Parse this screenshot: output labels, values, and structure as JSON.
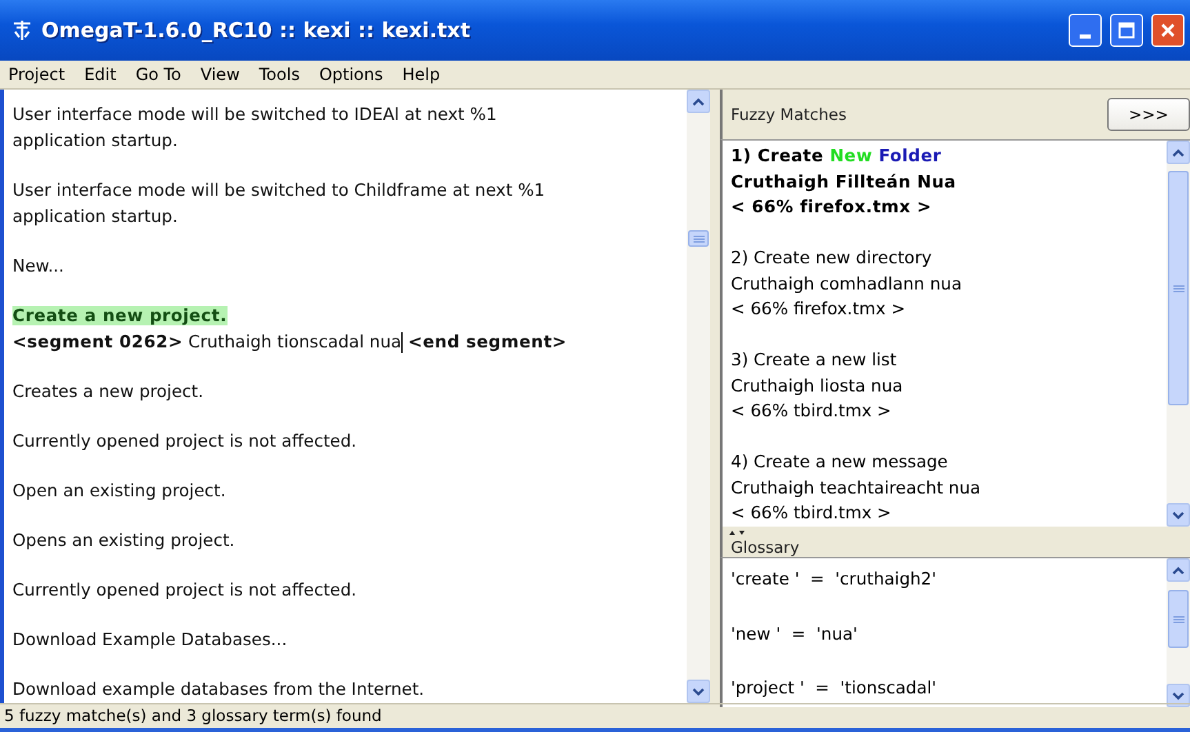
{
  "window": {
    "title": "OmegaT-1.6.0_RC10 :: kexi :: kexi.txt"
  },
  "menu": [
    "Project",
    "Edit",
    "Go To",
    "View",
    "Tools",
    "Options",
    "Help"
  ],
  "segments": [
    {
      "kind": "plain",
      "text": "User interface mode will be switched to IDEAl at next %1 application startup."
    },
    {
      "kind": "plain",
      "text": "User interface mode will be switched to Childframe at next %1 application startup."
    },
    {
      "kind": "plain",
      "text": "New..."
    },
    {
      "kind": "active",
      "text": "Create a new project.",
      "segment_tag": "<segment 0262>",
      "target": "Cruthaigh tionscadal nua",
      "end_tag": "<end segment>"
    },
    {
      "kind": "plain",
      "text": "Creates a new project."
    },
    {
      "kind": "plain",
      "text": "Currently opened project is not affected."
    },
    {
      "kind": "plain",
      "text": "Open an existing project."
    },
    {
      "kind": "plain",
      "text": "Opens an existing project."
    },
    {
      "kind": "plain",
      "text": "Currently opened project is not affected."
    },
    {
      "kind": "plain",
      "text": "Download Example Databases..."
    },
    {
      "kind": "plain",
      "text": "Download example databases from the Internet."
    }
  ],
  "fuzzy": {
    "title": "Fuzzy Matches",
    "button": ">>>",
    "matches": [
      {
        "number": "1)",
        "selected": true,
        "source_parts": [
          {
            "text": "Create",
            "color": "#000000"
          },
          {
            "text": "New",
            "color": "#22dd22"
          },
          {
            "text": "Folder",
            "color": "#1a1ab4"
          }
        ],
        "target": "Cruthaigh Fillteán Nua",
        "info": "< 66% firefox.tmx >"
      },
      {
        "number": "2)",
        "selected": false,
        "source_parts": [
          {
            "text": "Create new directory",
            "color": "#000000"
          }
        ],
        "target": "Cruthaigh comhadlann nua",
        "info": "< 66% firefox.tmx >"
      },
      {
        "number": "3)",
        "selected": false,
        "source_parts": [
          {
            "text": "Create a new list",
            "color": "#000000"
          }
        ],
        "target": "Cruthaigh liosta nua",
        "info": "< 66% tbird.tmx >"
      },
      {
        "number": "4)",
        "selected": false,
        "source_parts": [
          {
            "text": "Create a new message",
            "color": "#000000"
          }
        ],
        "target": "Cruthaigh teachtaireacht nua",
        "info": "< 66% tbird.tmx >"
      }
    ]
  },
  "glossary": {
    "title": "Glossary",
    "entries": [
      "'create '  =  'cruthaigh2'",
      "'new '  =  'nua'",
      "'project '  =  'tionscadal'"
    ]
  },
  "status_bar": "5 fuzzy matche(s) and 3 glossary term(s) found"
}
